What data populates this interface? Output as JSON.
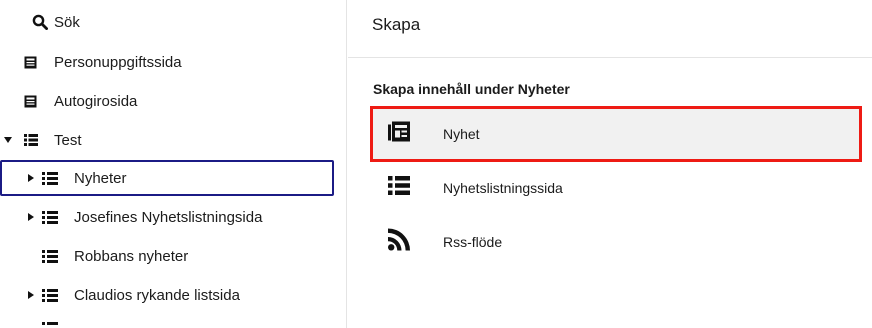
{
  "tree": {
    "items": [
      {
        "label": "Sök",
        "icon": "search-icon"
      },
      {
        "label": "Personuppgiftssida",
        "icon": "page-icon"
      },
      {
        "label": "Autogirosida",
        "icon": "page-icon"
      },
      {
        "label": "Test",
        "icon": "list-icon",
        "expanded": true
      },
      {
        "label": "Nyheter",
        "icon": "list-icon",
        "selected": true
      },
      {
        "label": "Josefines Nyhetslistningsida",
        "icon": "list-icon"
      },
      {
        "label": "Robbans nyheter",
        "icon": "list-icon"
      },
      {
        "label": "Claudios rykande listsida",
        "icon": "list-icon"
      }
    ],
    "selected_border_color": "#1b1b85"
  },
  "panel": {
    "title": "Skapa",
    "group_heading": "Skapa innehåll under Nyheter",
    "items": [
      {
        "label": "Nyhet",
        "icon": "news-icon",
        "highlighted": true
      },
      {
        "label": "Nyhetslistningssida",
        "icon": "list-icon"
      },
      {
        "label": "Rss-flöde",
        "icon": "rss-icon"
      }
    ],
    "highlight_color": "#ee1b14"
  }
}
